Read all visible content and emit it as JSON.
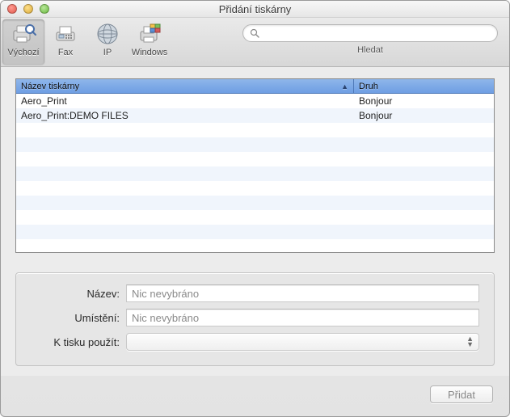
{
  "window": {
    "title": "Přidání tiskárny"
  },
  "toolbar": {
    "items": [
      {
        "label": "Výchozí",
        "icon": "printer-search-icon",
        "selected": true
      },
      {
        "label": "Fax",
        "icon": "fax-icon",
        "selected": false
      },
      {
        "label": "IP",
        "icon": "globe-icon",
        "selected": false
      },
      {
        "label": "Windows",
        "icon": "windows-printer-icon",
        "selected": false
      }
    ],
    "search": {
      "placeholder": "",
      "label": "Hledat"
    }
  },
  "table": {
    "columns": {
      "name": "Název tiskárny",
      "kind": "Druh"
    },
    "rows": [
      {
        "name": "Aero_Print",
        "kind": "Bonjour"
      },
      {
        "name": "Aero_Print:DEMO FILES",
        "kind": "Bonjour"
      }
    ]
  },
  "form": {
    "name_label": "Název:",
    "location_label": "Umístění:",
    "use_label": "K tisku použít:",
    "name_value": "Nic nevybráno",
    "location_value": "Nic nevybráno",
    "use_value": ""
  },
  "footer": {
    "add_label": "Přidat"
  }
}
